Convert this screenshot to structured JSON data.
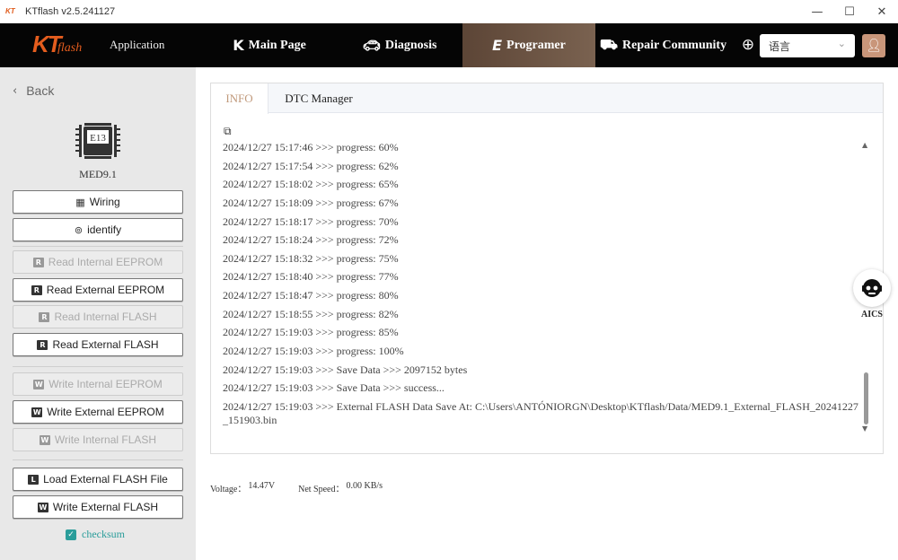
{
  "titlebar": {
    "title": "KTflash v2.5.241127",
    "logo_text": "KT"
  },
  "nav": {
    "brand_kt": "KT",
    "brand_flash": "flash",
    "app_label": "Application",
    "items": [
      {
        "label": "Main Page",
        "icon": "k-logo-icon"
      },
      {
        "label": "Diagnosis",
        "icon": "car-icon"
      },
      {
        "label": "Programer",
        "icon": "e-logo-icon"
      },
      {
        "label": "Repair Community",
        "icon": "repair-icon"
      }
    ],
    "language": "语言",
    "active": "Programer"
  },
  "sidebar": {
    "back_label": "Back",
    "ecu_chip_label": "E13",
    "ecu_name": "MED9.1",
    "buttons": [
      {
        "label": "Wiring",
        "enabled": true
      },
      {
        "label": "identify",
        "enabled": true
      },
      {
        "label": "Read Internal EEPROM",
        "enabled": false
      },
      {
        "label": "Read External EEPROM",
        "enabled": true
      },
      {
        "label": "Read Internal FLASH",
        "enabled": false
      },
      {
        "label": "Read External FLASH",
        "enabled": true
      },
      {
        "label": "Write Internal EEPROM",
        "enabled": false
      },
      {
        "label": "Write External EEPROM",
        "enabled": true
      },
      {
        "label": "Write Internal FLASH",
        "enabled": false
      },
      {
        "label": "Load External FLASH File",
        "enabled": true
      },
      {
        "label": "Write External FLASH",
        "enabled": true
      }
    ],
    "checksum_label": "checksum",
    "checksum_checked": true
  },
  "tabs": [
    {
      "label": "INFO",
      "active": true
    },
    {
      "label": "DTC Manager",
      "active": false
    }
  ],
  "log": [
    "2024/12/27 15:17:46 >>> progress: 60%",
    "2024/12/27 15:17:54 >>> progress: 62%",
    "2024/12/27 15:18:02 >>> progress: 65%",
    "2024/12/27 15:18:09 >>> progress: 67%",
    "2024/12/27 15:18:17 >>> progress: 70%",
    "2024/12/27 15:18:24 >>> progress: 72%",
    "2024/12/27 15:18:32 >>> progress: 75%",
    "2024/12/27 15:18:40 >>> progress: 77%",
    "2024/12/27 15:18:47 >>> progress: 80%",
    "2024/12/27 15:18:55 >>> progress: 82%",
    "2024/12/27 15:19:03 >>> progress: 85%",
    "2024/12/27 15:19:03 >>> progress: 100%",
    "2024/12/27 15:19:03 >>> Save Data >>>  2097152  bytes",
    "2024/12/27 15:19:03 >>> Save Data >>> success...",
    "2024/12/27 15:19:03 >>> External FLASH Data Save At: C:\\Users\\ANTÓNIORGN\\Desktop\\KTflash/Data/MED9.1_External_FLASH_20241227_151903.bin"
  ],
  "status": {
    "voltage_label": "Voltage：",
    "voltage_value": "14.47V",
    "speed_label": "Net Speed：",
    "speed_value": "0.00 KB/s"
  },
  "aics": {
    "label": "AICS"
  },
  "colors": {
    "accent": "#c0997b",
    "nav_bg": "#050505",
    "checksum": "#2a9d9a",
    "brand": "#e45d1e"
  }
}
